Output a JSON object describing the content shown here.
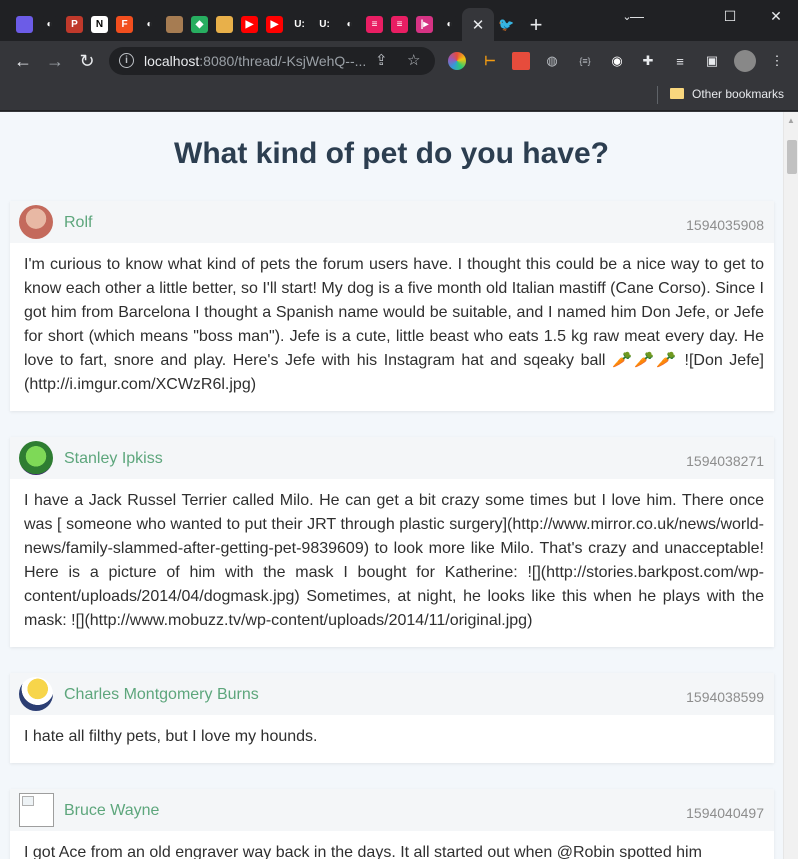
{
  "browser": {
    "tab_favicons": [
      {
        "icon": "bird-icon",
        "color": "#6c5ce7",
        "glyph": ""
      },
      {
        "icon": "github-icon",
        "color": "#202124",
        "glyph": "◐"
      },
      {
        "icon": "p-icon",
        "color": "#c0392b",
        "glyph": "P"
      },
      {
        "icon": "notion-icon",
        "color": "#ffffff",
        "glyph": "N"
      },
      {
        "icon": "figma-icon",
        "color": "#f24e1e",
        "glyph": "F"
      },
      {
        "icon": "github-icon",
        "color": "#202124",
        "glyph": "◐"
      },
      {
        "icon": "photo-icon",
        "color": "#a67c52",
        "glyph": ""
      },
      {
        "icon": "cube-icon",
        "color": "#27ae60",
        "glyph": "◆"
      },
      {
        "icon": "person-icon",
        "color": "#e8b04a",
        "glyph": ""
      },
      {
        "icon": "youtube-icon",
        "color": "#ff0000",
        "glyph": "▶"
      },
      {
        "icon": "youtube-icon",
        "color": "#ff0000",
        "glyph": "▶"
      },
      {
        "icon": "u-icon",
        "color": "#202124",
        "glyph": "U:"
      },
      {
        "icon": "u-icon",
        "color": "#202124",
        "glyph": "U:"
      },
      {
        "icon": "github-icon",
        "color": "#202124",
        "glyph": "◐"
      },
      {
        "icon": "stripe-icon",
        "color": "#e91e63",
        "glyph": "≡"
      },
      {
        "icon": "stripe-icon",
        "color": "#e91e63",
        "glyph": "≡"
      },
      {
        "icon": "bars-icon",
        "color": "#d63384",
        "glyph": "|▸"
      },
      {
        "icon": "github-icon",
        "color": "#202124",
        "glyph": "◐"
      }
    ],
    "active_tab_close": "✕",
    "twitter_glyph": "🐦",
    "new_tab": "+",
    "window": {
      "minimize": "—",
      "maximize": "☐",
      "close": "✕"
    },
    "url_host": "localhost",
    "url_rest": ":8080/thread/-KsjWehQ--...",
    "bookmarks_label": "Other bookmarks"
  },
  "thread": {
    "title": "What kind of pet do you have?",
    "posts": [
      {
        "user": "Rolf",
        "timestamp": "1594035908",
        "avatar_color": "#d9a08a",
        "text": "I'm curious to know what kind of pets the forum users have. I thought this could be a nice way to get to know each other a little better, so I'll start! My dog is a five month old Italian mastiff (Cane Corso). Since I got him from Barcelona I thought a Spanish name would be suitable, and I named him Don Jefe, or Jefe for short (which means \"boss man\"). Jefe is a cute, little beast who eats 1.5 kg raw meat every day. He love to fart, snore and play. Here's Jefe with his Instagram hat and sqeaky ball 🥕🥕🥕 ![Don Jefe](http://i.imgur.com/XCWzR6l.jpg)"
      },
      {
        "user": "Stanley Ipkiss",
        "timestamp": "1594038271",
        "avatar_color": "#4caf50",
        "text": "I have a Jack Russel Terrier called Milo. He can get a bit crazy some times but I love him. There once was [ someone who wanted to put their JRT through plastic surgery](http://www.mirror.co.uk/news/world-news/family-slammed-after-getting-pet-9839609) to look more like Milo. That's crazy and unacceptable! Here is a picture of him with the mask I bought for Katherine: ![](http://stories.barkpost.com/wp-content/uploads/2014/04/dogmask.jpg) Sometimes, at night, he looks like this when he plays with the mask: ![](http://www.mobuzz.tv/wp-content/uploads/2014/11/original.jpg)"
      },
      {
        "user": "Charles Montgomery Burns",
        "timestamp": "1594038599",
        "avatar_color": "#f1c40f",
        "text": "I hate all filthy pets, but I love my hounds."
      },
      {
        "user": "Bruce Wayne",
        "timestamp": "1594040497",
        "avatar_color": "",
        "text": "I got Ace from an old engraver way back in the days. It all started out when @Robin spotted him"
      }
    ]
  }
}
